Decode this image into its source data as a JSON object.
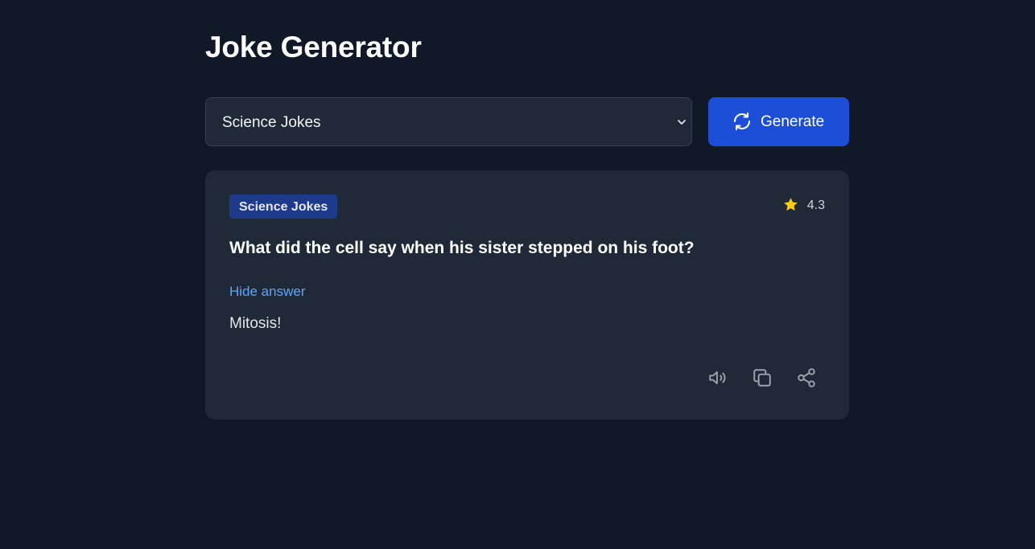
{
  "header": {
    "title": "Joke Generator"
  },
  "controls": {
    "category_select": {
      "selected": "Science Jokes",
      "icon": "chevron-down-icon"
    },
    "generate_button": {
      "label": "Generate",
      "icon": "refresh-icon",
      "color": "#1d4ed8"
    }
  },
  "joke": {
    "category": "Science Jokes",
    "rating": "4.3",
    "rating_icon": "star-icon",
    "question": "What did the cell say when his sister stepped on his foot?",
    "toggle_label": "Hide answer",
    "answer": "Mitosis!",
    "actions": [
      {
        "name": "speak",
        "icon": "speaker-icon"
      },
      {
        "name": "copy",
        "icon": "copy-icon"
      },
      {
        "name": "share",
        "icon": "share-icon"
      }
    ]
  },
  "colors": {
    "background": "#111827",
    "card": "#1f2937",
    "accent": "#1d4ed8",
    "link": "#60a5fa",
    "badge": "#1e3a8a",
    "star": "#facc15"
  }
}
